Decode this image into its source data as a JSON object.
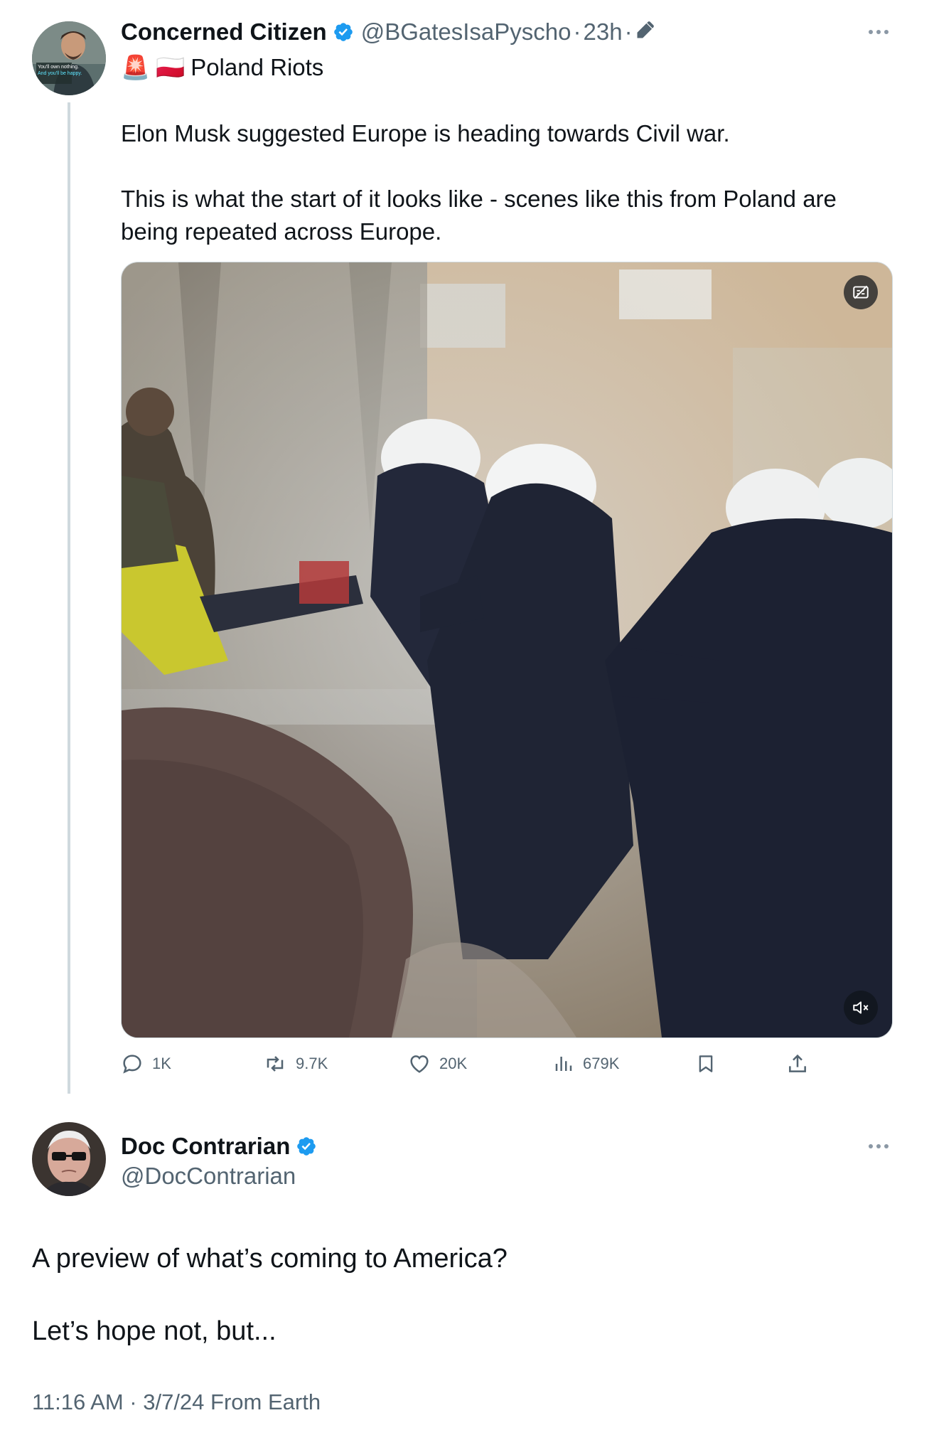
{
  "parent_tweet": {
    "display_name": "Concerned Citizen",
    "handle": "@BGatesIsaPyscho",
    "sep1": "·",
    "time": "23h",
    "sep2": "·",
    "title_emoji_1": "🚨",
    "title_emoji_2": "🇵🇱",
    "title": "Poland Riots",
    "avatar_text_line1": "You'll own nothing.",
    "avatar_text_line2": "And you'll be happy.",
    "body_line1": "Elon Musk suggested Europe is heading towards Civil war.",
    "body_line2": "This is what the start of it looks like - scenes like this from Poland are being repeated across Europe.",
    "stats": {
      "replies": "1K",
      "reposts": "9.7K",
      "likes": "20K",
      "views": "679K"
    }
  },
  "main_tweet": {
    "display_name": "Doc Contrarian",
    "handle": "@DocContrarian",
    "body_line1": "A preview of what’s coming to America?",
    "body_line2": "Let’s hope not, but...",
    "timestamp": "11:16 AM · 3/7/24 From Earth"
  },
  "colors": {
    "verified": "#1d9bf0",
    "text": "#0f1419",
    "secondary": "#536471",
    "thread_line": "#cfd9de"
  },
  "icons": [
    "verified-badge-icon",
    "edit-pencil-icon",
    "more-icon",
    "gif-caption-icon",
    "mute-icon",
    "reply-icon",
    "repost-icon",
    "like-icon",
    "views-icon",
    "bookmark-icon",
    "share-icon"
  ]
}
